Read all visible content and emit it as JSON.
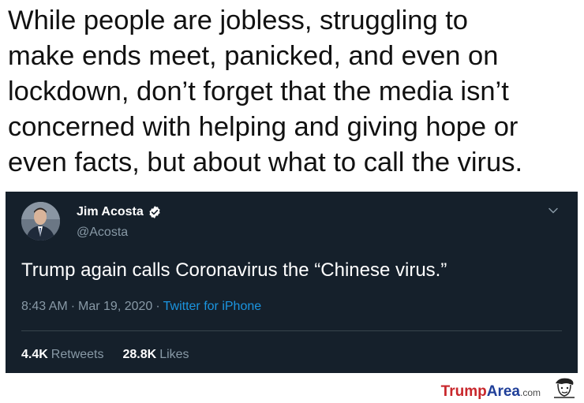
{
  "caption": {
    "lines": [
      "While people are jobless, struggling to",
      "make ends meet, panicked, and even on",
      "lockdown, don’t forget that the media isn’t",
      "concerned with helping and giving hope or",
      "even facts, but about what to call the virus."
    ]
  },
  "tweet": {
    "display_name": "Jim Acosta",
    "handle": "@Acosta",
    "text": "Trump again calls Coronavirus the “Chinese virus.”",
    "time": "8:43 AM",
    "date": "Mar 19, 2020",
    "separator": "·",
    "source": "Twitter for iPhone",
    "retweets_count": "4.4K",
    "retweets_label": "Retweets",
    "likes_count": "28.8K",
    "likes_label": "Likes",
    "icons": {
      "verified": "verified-badge-icon",
      "chevron": "chevron-down-icon"
    },
    "colors": {
      "background": "#15202b",
      "secondary_text": "#8899a6",
      "link": "#1b95e0"
    }
  },
  "watermark": {
    "part1": "Trump",
    "part2": "Area",
    "part3": ".com",
    "colors": {
      "part1": "#c8262b",
      "part2": "#1f3f99"
    }
  }
}
